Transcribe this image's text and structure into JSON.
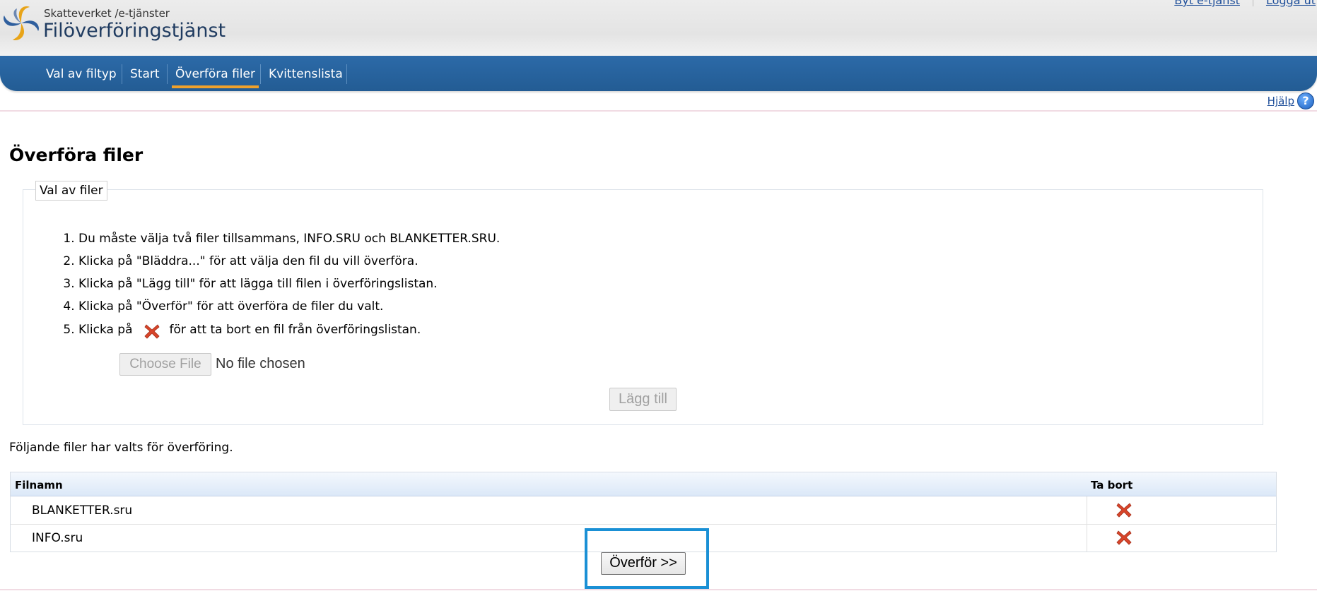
{
  "header": {
    "agency": "Skatteverket /e-tjänster",
    "app_name": "Filöverföringstjänst",
    "links": [
      "Byt e-tjänst",
      "Logga ut"
    ]
  },
  "nav": {
    "items": [
      "Val av filtyp",
      "Start",
      "Överföra filer",
      "Kvittenslista"
    ],
    "active": "Överföra filer",
    "active_color": "#f0a12b"
  },
  "help": {
    "label": "Hjälp",
    "icon": "question-icon"
  },
  "main": {
    "title": "Överföra filer",
    "legend": "Val av filer",
    "steps": [
      "Du måste välja två filer tillsammans, INFO.SRU och BLANKETTER.SRU.",
      "Klicka på \"Bläddra...\" för att välja den fil du vill överföra.",
      "Klicka på \"Lägg till\" för att lägga till filen i överföringslistan.",
      "Klicka på \"Överför\" för att överföra de filer du valt."
    ],
    "step5_before": "Klicka på",
    "step5_after": "för att ta bort en fil från överföringslistan.",
    "choose_file_label": "Choose File",
    "no_file_text": "No file chosen",
    "add_button": "Lägg till",
    "selected_text": "Följande filer har valts för överföring."
  },
  "table": {
    "columns": [
      "Filnamn",
      "Ta bort"
    ],
    "rows": [
      {
        "name": "BLANKETTER.sru",
        "action_icon": "delete-x-icon"
      },
      {
        "name": "INFO.sru",
        "action_icon": "delete-x-icon"
      }
    ]
  },
  "transfer_button": "Överför >>",
  "colors": {
    "nav": "#2a66a3",
    "title": "#1f3b60",
    "highlight": "#1a90d5",
    "delete": "#d8452a"
  }
}
